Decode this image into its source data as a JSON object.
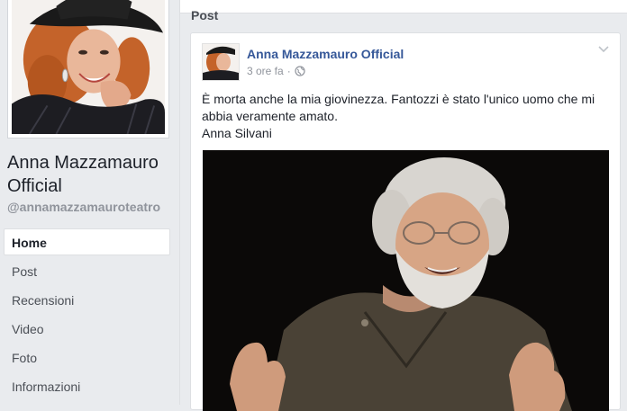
{
  "page": {
    "name": "Anna Mazzamauro Official",
    "handle": "@annamazzamauroteatro"
  },
  "nav": {
    "items": [
      {
        "label": "Home",
        "active": true
      },
      {
        "label": "Post",
        "active": false
      },
      {
        "label": "Recensioni",
        "active": false
      },
      {
        "label": "Video",
        "active": false
      },
      {
        "label": "Foto",
        "active": false
      },
      {
        "label": "Informazioni",
        "active": false
      }
    ]
  },
  "main": {
    "section_label": "Post"
  },
  "post": {
    "author": "Anna Mazzamauro Official",
    "time": "3 ore fa",
    "separator": "·",
    "privacy_icon": "globe-icon",
    "menu_icon": "chevron-down-icon",
    "lines": [
      "È morta anche la mia giovinezza. Fantozzi è stato l'unico uomo che mi abbia veramente amato.",
      "Anna Silvani"
    ]
  },
  "colors": {
    "background": "#e9ebee",
    "link": "#365899",
    "muted": "#90949c"
  }
}
